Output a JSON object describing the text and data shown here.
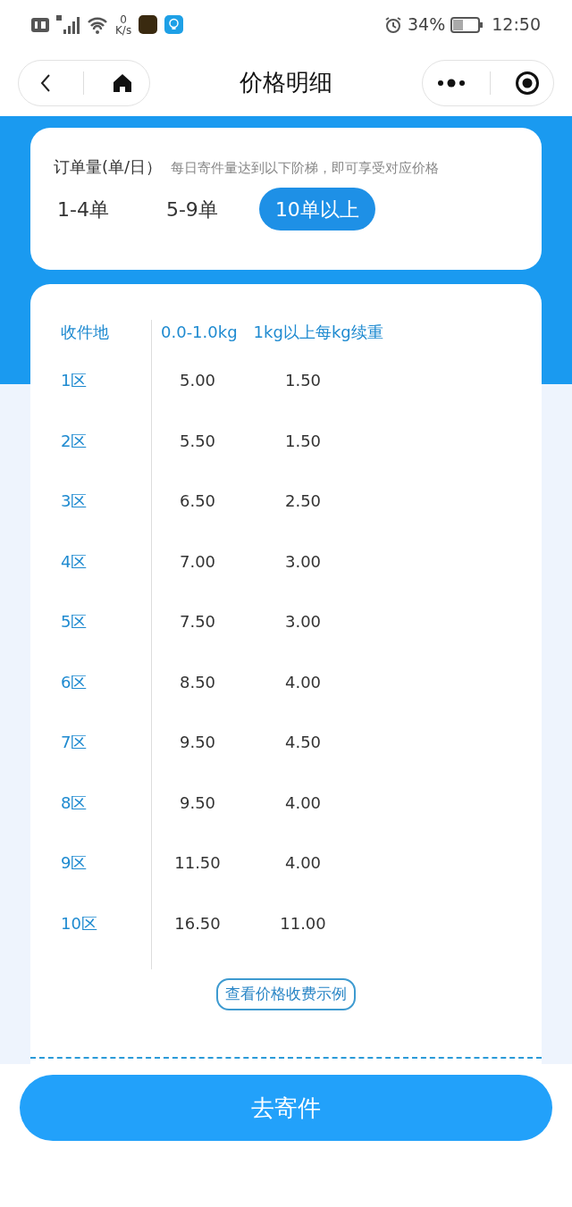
{
  "status_bar": {
    "speed_value": "0",
    "speed_unit": "K/s",
    "battery": "34%",
    "time": "12:50"
  },
  "nav": {
    "title": "价格明细"
  },
  "order_volume": {
    "label": "订单量(单/日）",
    "hint": "每日寄件量达到以下阶梯，即可享受对应价格",
    "tiers": [
      {
        "label": "1-4单",
        "selected": false
      },
      {
        "label": "5-9单",
        "selected": false
      },
      {
        "label": "10单以上",
        "selected": true
      }
    ]
  },
  "price_table": {
    "columns": [
      "收件地",
      "0.0-1.0kg",
      "1kg以上每kg续重"
    ],
    "rows": [
      [
        "1区",
        "5.00",
        "1.50"
      ],
      [
        "2区",
        "5.50",
        "1.50"
      ],
      [
        "3区",
        "6.50",
        "2.50"
      ],
      [
        "4区",
        "7.00",
        "3.00"
      ],
      [
        "5区",
        "7.50",
        "3.00"
      ],
      [
        "6区",
        "8.50",
        "4.00"
      ],
      [
        "7区",
        "9.50",
        "4.50"
      ],
      [
        "8区",
        "9.50",
        "4.00"
      ],
      [
        "9区",
        "11.50",
        "4.00"
      ],
      [
        "10区",
        "16.50",
        "11.00"
      ]
    ]
  },
  "example_link": "查看价格收费示例",
  "send_button": "去寄件"
}
